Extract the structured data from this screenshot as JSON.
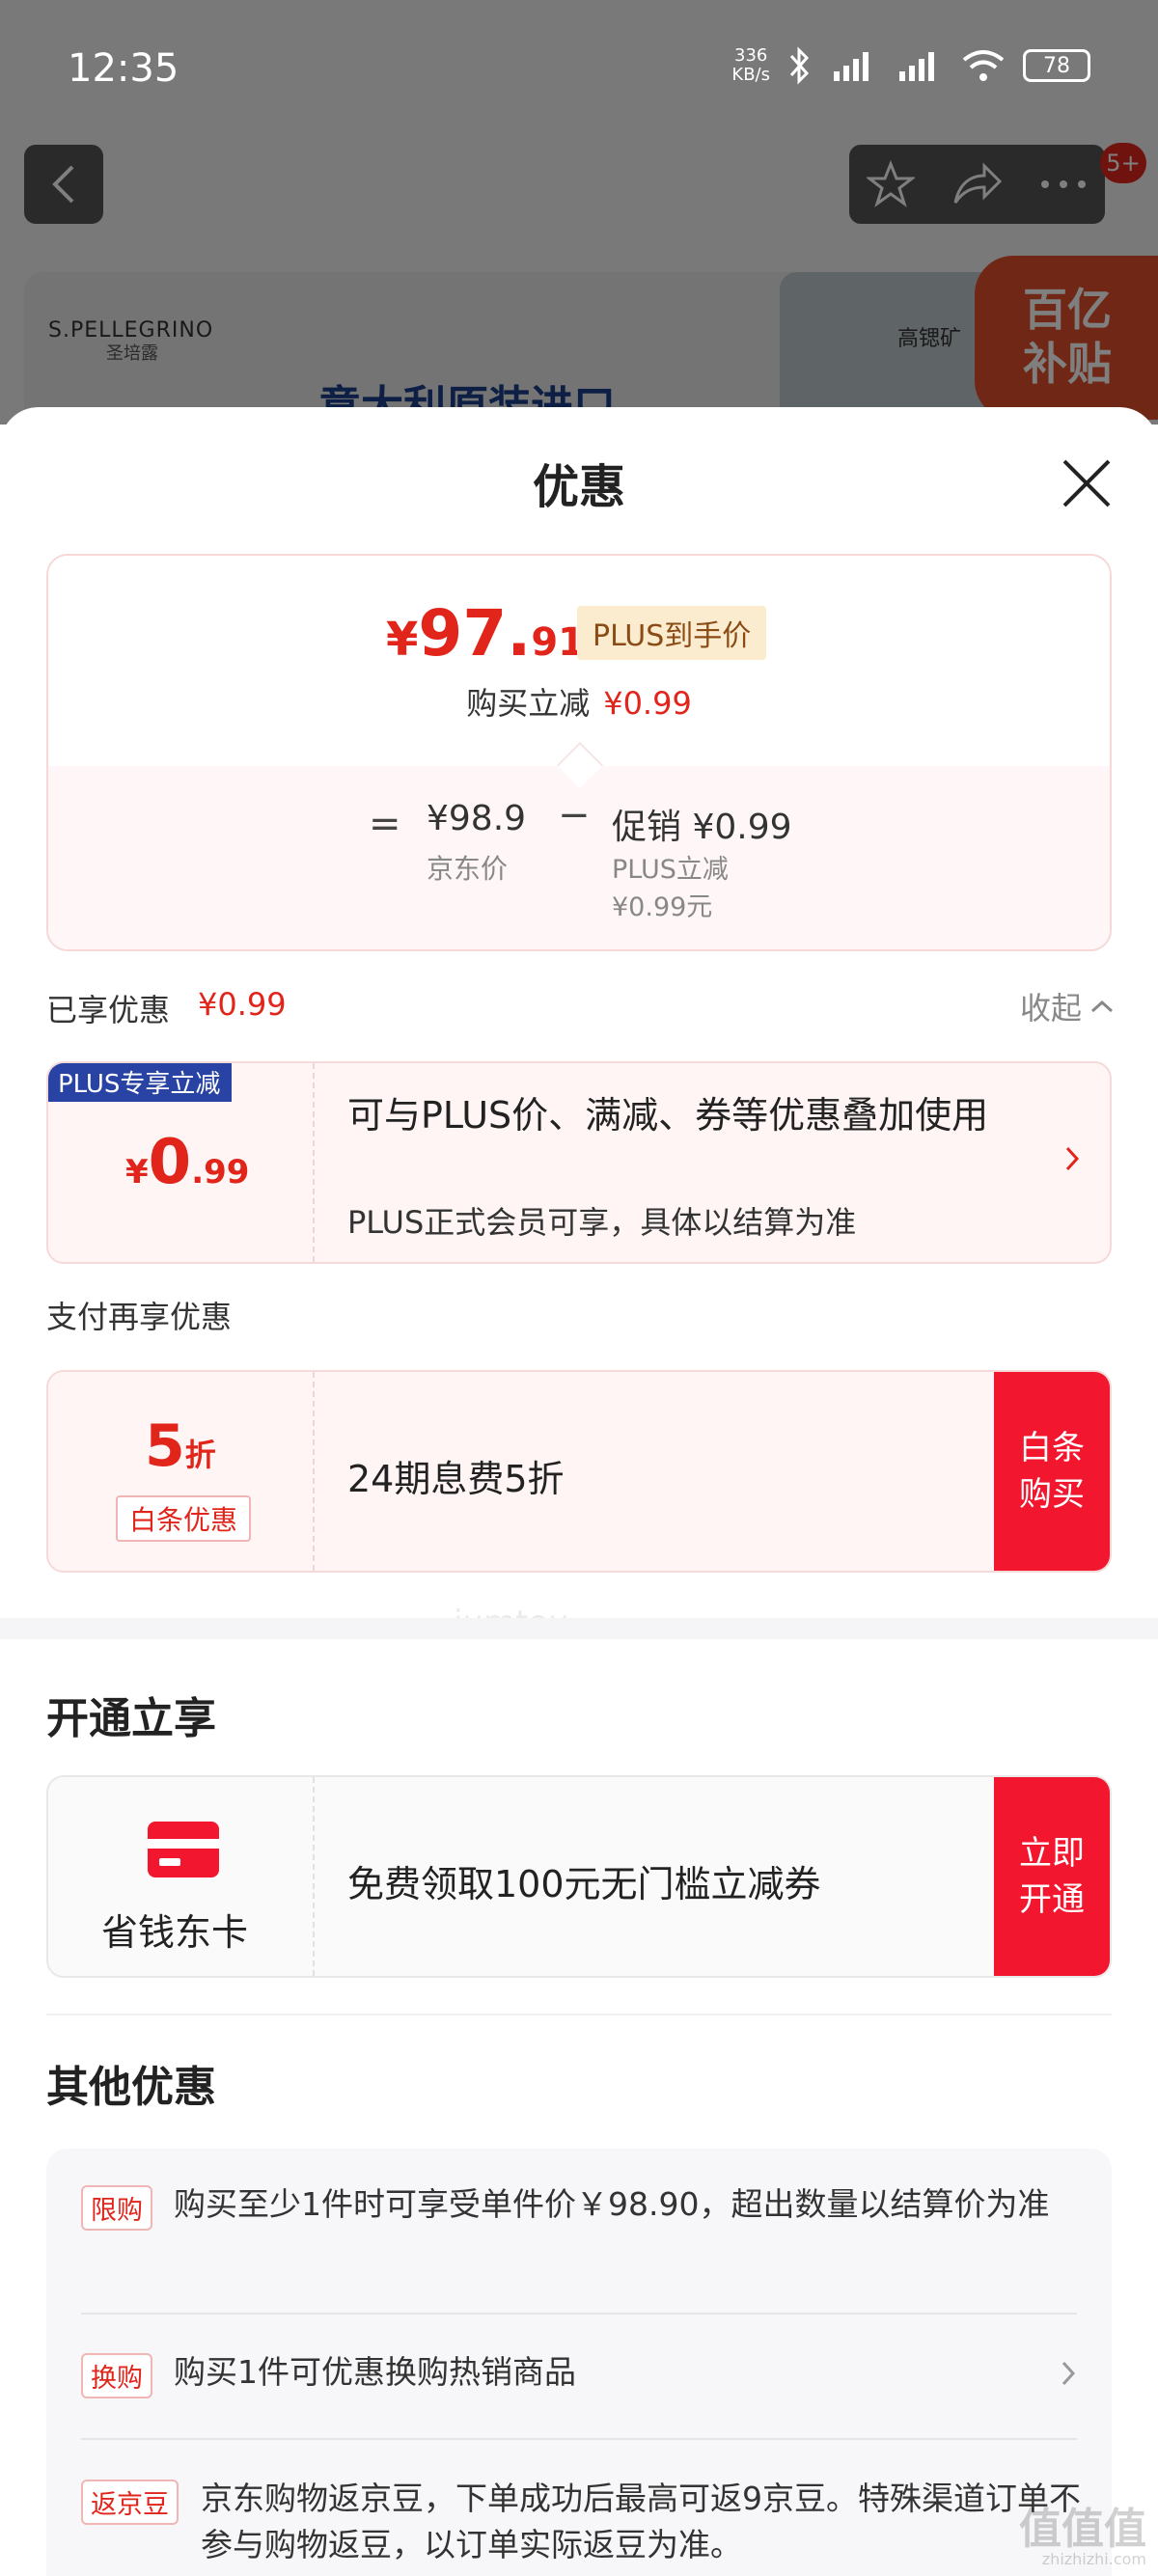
{
  "status_bar": {
    "time": "12:35",
    "speed_value": "336",
    "speed_unit": "KB/s",
    "battery": "78"
  },
  "background": {
    "badge_count": "5+",
    "brand": "S.PELLEGRINO",
    "brand_sub": "圣培露",
    "banner_title": "意大利原装进口",
    "banner_img_text": "高锶矿",
    "subsidy_line1": "百亿",
    "subsidy_line2": "补贴"
  },
  "sheet": {
    "title": "优惠"
  },
  "price_card": {
    "yen": "¥",
    "price_int": "97.",
    "price_dec": "91",
    "plus_tag": "PLUS到手价",
    "buy_reduce_label": "购买立减",
    "buy_reduce_amount": "¥0.99",
    "eq": "=",
    "jd_price": "¥98.9",
    "jd_price_label": "京东价",
    "minus": "−",
    "promo": "促销 ¥0.99",
    "plus_reduce_label": "PLUS立减",
    "plus_reduce_amount": "¥0.99元"
  },
  "enjoyed": {
    "label": "已享优惠",
    "amount": "¥0.99",
    "collapse": "收起"
  },
  "plus_coupon": {
    "tag": "PLUS专享立减",
    "yen": "¥",
    "amount_int": "0",
    "amount_dec": ".99",
    "title": "可与PLUS价、满减、券等优惠叠加使用",
    "subtitle": "PLUS正式会员可享，具体以结算为准"
  },
  "pay_section": {
    "label": "支付再享优惠",
    "value": "5",
    "unit": "折",
    "badge": "白条优惠",
    "title": "24期息费5折",
    "button": "白条\n购买"
  },
  "open_section": {
    "title": "开通立享",
    "card_label": "省钱东卡",
    "desc": "免费领取100元无门槛立减券",
    "button": "立即\n开通"
  },
  "other_section": {
    "title": "其他优惠",
    "items": [
      {
        "tag": "限购",
        "text": "购买至少1件时可享受单件价￥98.90，超出数量以结算价为准"
      },
      {
        "tag": "换购",
        "text": "购买1件可优惠换购热销商品"
      },
      {
        "tag": "返京豆",
        "text": "京东购物返京豆，下单成功后最高可返9京豆。特殊渠道订单不参与购物返豆，以订单实际返豆为准。"
      }
    ]
  },
  "watermarks": {
    "center": "iumtou",
    "site": "值值值",
    "site_url": "zhizhizhi.com"
  },
  "colors": {
    "accent_red": "#e1251b",
    "button_red": "#f2162e",
    "plus_blue": "#2843a3",
    "plus_gold_bg": "#fbecd0"
  }
}
